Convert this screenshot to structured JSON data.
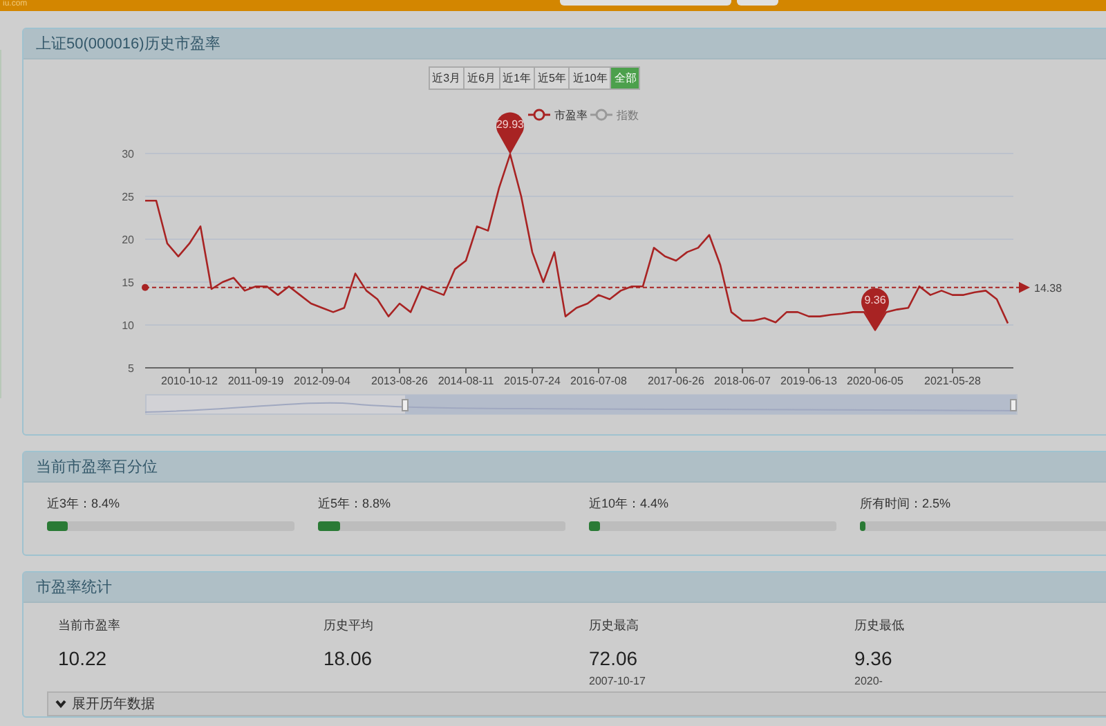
{
  "header": {
    "logo": "iu.com"
  },
  "pe_history": {
    "title": "上证50(000016)历史市盈率",
    "ranges": [
      {
        "label": "近3月",
        "selected": false
      },
      {
        "label": "近6月",
        "selected": false
      },
      {
        "label": "近1年",
        "selected": false
      },
      {
        "label": "近5年",
        "selected": false
      },
      {
        "label": "近10年",
        "selected": false
      },
      {
        "label": "全部",
        "selected": true
      }
    ],
    "extra_legend": [
      {
        "label": "指数",
        "on": false
      }
    ],
    "chart_data": {
      "type": "line",
      "grid": true,
      "ylim": [
        5,
        30
      ],
      "yticks": [
        5,
        10,
        15,
        20,
        25,
        30
      ],
      "categories": [
        null,
        null,
        null,
        null,
        "2010-10-12",
        null,
        null,
        null,
        null,
        null,
        "2011-09-19",
        null,
        null,
        null,
        null,
        null,
        "2012-09-04",
        null,
        null,
        null,
        null,
        null,
        null,
        "2013-08-26",
        null,
        null,
        null,
        null,
        null,
        "2014-08-11",
        null,
        null,
        null,
        null,
        null,
        "2015-07-24",
        null,
        null,
        null,
        null,
        null,
        "2016-07-08",
        null,
        null,
        null,
        null,
        null,
        null,
        "2017-06-26",
        null,
        null,
        null,
        null,
        null,
        "2018-06-07",
        null,
        null,
        null,
        null,
        null,
        "2019-06-13",
        null,
        null,
        null,
        null,
        null,
        "2020-06-05",
        null,
        null,
        null,
        null,
        null,
        null,
        "2021-05-28",
        null,
        null,
        null,
        null,
        null
      ],
      "series": [
        {
          "name": "市盈率",
          "color": "#a82323",
          "values": [
            24.5,
            24.5,
            19.5,
            18,
            19.5,
            21.5,
            14.2,
            15,
            15.5,
            14,
            14.5,
            14.5,
            13.5,
            14.5,
            13.5,
            12.5,
            12,
            11.5,
            12,
            16,
            14,
            13,
            11,
            12.5,
            11.5,
            14.5,
            14,
            13.5,
            16.5,
            17.5,
            21.5,
            21,
            26,
            29.9,
            25,
            18.5,
            15,
            18.5,
            11,
            12,
            12.5,
            13.5,
            13,
            14,
            14.5,
            14.5,
            19,
            18,
            17.5,
            18.5,
            19,
            20.5,
            17,
            11.5,
            10.5,
            10.5,
            10.8,
            10.3,
            11.5,
            11.5,
            11,
            11,
            11.2,
            11.3,
            11.5,
            11.5,
            9.4,
            11.5,
            11.8,
            12,
            14.5,
            13.5,
            14,
            13.5,
            13.5,
            13.8,
            14,
            13,
            10.2
          ]
        }
      ],
      "ref_lines": [
        {
          "axis": "y",
          "value": 14.38,
          "label": "14.38"
        }
      ]
    },
    "markers": [
      {
        "kind": "max",
        "text": "29.93"
      },
      {
        "kind": "min",
        "text": "9.36"
      }
    ]
  },
  "percentile": {
    "title": "当前市盈率百分位",
    "items": [
      {
        "label": "近3年：8.4%",
        "level": 0.084
      },
      {
        "label": "近5年：8.8%",
        "level": 0.088
      },
      {
        "label": "近10年：4.4%",
        "level": 0.044
      },
      {
        "label": "所有时间：2.5%",
        "level": 0.025
      }
    ]
  },
  "stats": {
    "title": "市盈率统计",
    "items": [
      {
        "label": "当前市盈率",
        "value": "10.22"
      },
      {
        "label": "历史平均",
        "value": "18.06"
      },
      {
        "label": "历史最高",
        "value": "72.06",
        "date": "2007-10-17"
      },
      {
        "label": "历史最低",
        "value": "9.36",
        "date": "2020-"
      }
    ],
    "expand_button": "展开历年数据"
  }
}
